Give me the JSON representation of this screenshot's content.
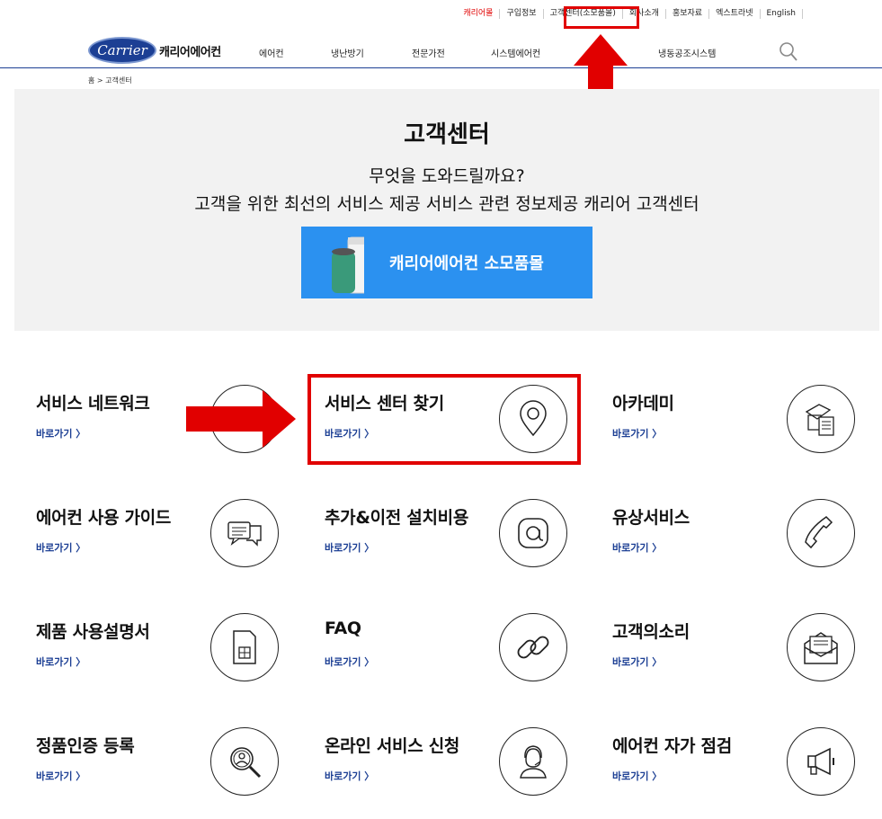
{
  "util_links": [
    {
      "label": "캐리어몰",
      "style": "red"
    },
    {
      "label": "구입정보",
      "style": ""
    },
    {
      "label": "고객센터(소모품몰)",
      "style": "cs"
    },
    {
      "label": "회사소개",
      "style": ""
    },
    {
      "label": "홍보자료",
      "style": ""
    },
    {
      "label": "엑스트라넷",
      "style": ""
    },
    {
      "label": "English",
      "style": ""
    }
  ],
  "logo": {
    "oval_text": "Carrier",
    "brand": "캐리어에어컨"
  },
  "nav": [
    "에어컨",
    "냉난방기",
    "전문가전",
    "시스템에어컨",
    "냉동공조시스템"
  ],
  "breadcrumb": "홈 > 고객센터",
  "hero": {
    "title": "고객센터",
    "sub1": "무엇을 도와드릴까요?",
    "sub2": "고객을 위한 최선의 서비스 제공 서비스 관련 정보제공 캐리어 고객센터",
    "button": "캐리어에어컨 소모품몰"
  },
  "cards": [
    {
      "title": "서비스 네트워크",
      "link": "바로가기 〉",
      "icon": "network-icon"
    },
    {
      "title": "서비스 센터 찾기",
      "link": "바로가기 〉",
      "icon": "location-pin-icon"
    },
    {
      "title": "아카데미",
      "link": "바로가기 〉",
      "icon": "documents-icon"
    },
    {
      "title": "에어컨 사용 가이드",
      "link": "바로가기 〉",
      "icon": "chat-bubbles-icon"
    },
    {
      "title": "추가&이전 설치비용",
      "link": "바로가기 〉",
      "icon": "at-sign-icon"
    },
    {
      "title": "유상서비스",
      "link": "바로가기 〉",
      "icon": "phone-icon"
    },
    {
      "title": "제품 사용설명서",
      "link": "바로가기 〉",
      "icon": "sim-card-icon"
    },
    {
      "title": "FAQ",
      "link": "바로가기 〉",
      "icon": "chain-link-icon"
    },
    {
      "title": "고객의소리",
      "link": "바로가기 〉",
      "icon": "envelope-letter-icon"
    },
    {
      "title": "정품인증 등록",
      "link": "바로가기 〉",
      "icon": "search-user-icon"
    },
    {
      "title": "온라인 서비스 신청",
      "link": "바로가기 〉",
      "icon": "headset-agent-icon"
    },
    {
      "title": "에어컨 자가 점검",
      "link": "바로가기 〉",
      "icon": "megaphone-icon"
    }
  ],
  "colors": {
    "accent": "#1c3f94",
    "button": "#2b91f0",
    "highlight": "#e10000"
  }
}
